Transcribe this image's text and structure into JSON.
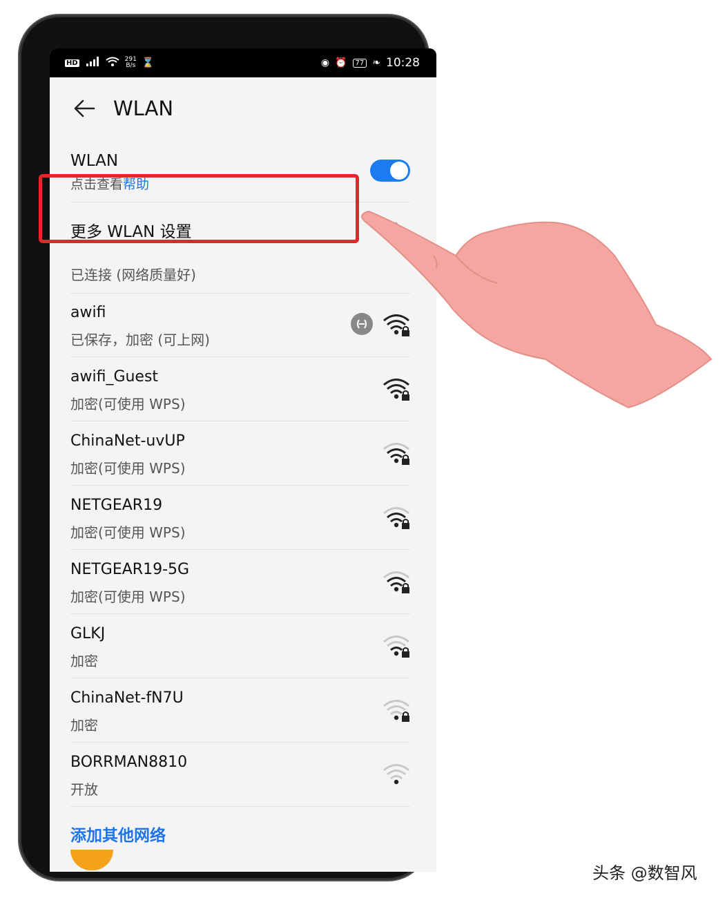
{
  "status_bar": {
    "hd": "HD",
    "speed_top": "291",
    "speed_bottom": "B/s",
    "battery": "77",
    "time": "10:28"
  },
  "header": {
    "title": "WLAN"
  },
  "wlan_toggle": {
    "label": "WLAN",
    "sub_prefix": "点击查看",
    "sub_link": "帮助",
    "on": true
  },
  "more_settings": {
    "label": "更多 WLAN 设置"
  },
  "connected": {
    "status": "已连接 (网络质量好)"
  },
  "networks": [
    {
      "name": "awifi",
      "status": "已保存，加密 (可上网)",
      "locked": true,
      "shared": true,
      "signal": 4
    },
    {
      "name": "awifi_Guest",
      "status": "加密(可使用 WPS)",
      "locked": true,
      "signal": 4
    },
    {
      "name": "ChinaNet-uvUP",
      "status": "加密(可使用 WPS)",
      "locked": true,
      "signal": 3
    },
    {
      "name": "NETGEAR19",
      "status": "加密(可使用 WPS)",
      "locked": true,
      "signal": 3
    },
    {
      "name": "NETGEAR19-5G",
      "status": "加密(可使用 WPS)",
      "locked": true,
      "signal": 3
    },
    {
      "name": "GLKJ",
      "status": "加密",
      "locked": true,
      "signal": 2
    },
    {
      "name": "ChinaNet-fN7U",
      "status": "加密",
      "locked": true,
      "signal": 1
    },
    {
      "name": "BORRMAN8810",
      "status": "开放",
      "locked": false,
      "signal": 1
    }
  ],
  "add_network": {
    "label": "添加其他网络"
  },
  "watermark": "头条 @数智风",
  "colors": {
    "accent": "#1e74e8",
    "highlight": "#e2262c",
    "toggle": "#1a7cf0"
  }
}
